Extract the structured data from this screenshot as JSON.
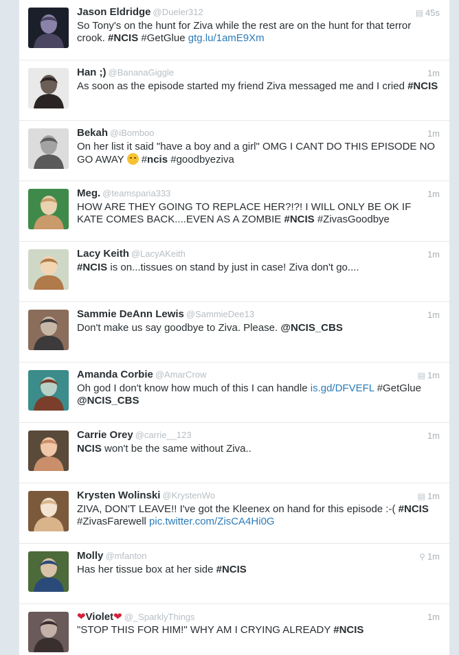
{
  "colors": {
    "link": "#2b7bb9",
    "handle": "#b7bec4",
    "text": "#292f33"
  },
  "tweets": [
    {
      "name": "Jason Eldridge",
      "handle": "@Dueler312",
      "time": "45s",
      "icon": "newspaper-icon",
      "segments": [
        {
          "t": "So Tony's on the hunt for Ziva while the rest are on the hunt for that terror crook. "
        },
        {
          "t": "#NCIS",
          "s": "b"
        },
        {
          "t": " #GetGlue "
        },
        {
          "t": "gtg.lu/1amE9Xm",
          "s": "link"
        }
      ]
    },
    {
      "name": "Han ;)",
      "handle": "@BananaGiggle",
      "time": "1m",
      "icon": "",
      "segments": [
        {
          "t": "As soon as the episode started my friend Ziva messaged me and I cried "
        },
        {
          "t": "#NCIS",
          "s": "b"
        }
      ]
    },
    {
      "name": "Bekah",
      "handle": "@iBomboo",
      "time": "1m",
      "icon": "",
      "segments": [
        {
          "t": "On her list it said \"have a boy and a girl\" OMG I CANT DO THIS EPISODE NO GO AWAY "
        },
        {
          "t": "",
          "s": "emoji"
        },
        {
          "t": " #"
        },
        {
          "t": "ncis",
          "s": "b"
        },
        {
          "t": " #goodbyeziva"
        }
      ]
    },
    {
      "name": "Meg.",
      "handle": "@teamsparia333",
      "time": "1m",
      "icon": "",
      "segments": [
        {
          "t": "HOW ARE THEY GOING TO REPLACE HER?!?! I WILL ONLY BE OK IF KATE COMES BACK....EVEN AS A ZOMBIE "
        },
        {
          "t": "#NCIS",
          "s": "b"
        },
        {
          "t": " #ZivasGoodbye"
        }
      ]
    },
    {
      "name": "Lacy Keith",
      "handle": "@LacyAKeith",
      "time": "1m",
      "icon": "",
      "segments": [
        {
          "t": "#NCIS",
          "s": "b"
        },
        {
          "t": " is on...tissues on stand by just in case!  Ziva don't go...."
        }
      ]
    },
    {
      "name": "Sammie DeAnn Lewis",
      "handle": "@SammieDee13",
      "time": "1m",
      "icon": "",
      "segments": [
        {
          "t": "Don't make us say goodbye to Ziva. Please. "
        },
        {
          "t": "@NCIS_CBS",
          "s": "b"
        }
      ]
    },
    {
      "name": "Amanda Corbie",
      "handle": "@AmarCrow",
      "time": "1m",
      "icon": "newspaper-icon",
      "segments": [
        {
          "t": "Oh god I don't know how much of this I can handle "
        },
        {
          "t": "is.gd/DFVEFL",
          "s": "link"
        },
        {
          "t": " #GetGlue "
        },
        {
          "t": "@NCIS_CBS",
          "s": "b"
        }
      ]
    },
    {
      "name": "Carrie Orey",
      "handle": "@carrie__123",
      "time": "1m",
      "icon": "",
      "segments": [
        {
          "t": "NCIS",
          "s": "b"
        },
        {
          "t": " won't be the same without Ziva.."
        }
      ]
    },
    {
      "name": "Krysten Wolinski",
      "handle": "@KrystenWo",
      "time": "1m",
      "icon": "photo-icon",
      "segments": [
        {
          "t": "ZIVA, DON'T LEAVE!! I've got the Kleenex on hand for this episode :-(  "
        },
        {
          "t": "#NCIS",
          "s": "b"
        },
        {
          "t": " #ZivasFarewell "
        },
        {
          "t": "pic.twitter.com/ZisCA4Hi0G",
          "s": "link"
        }
      ]
    },
    {
      "name": "Molly",
      "handle": "@mfanton",
      "time": "1m",
      "icon": "location-pin-icon",
      "segments": [
        {
          "t": "Has her tissue box at her side "
        },
        {
          "t": "#NCIS",
          "s": "b"
        }
      ]
    },
    {
      "name": "Violet",
      "handle": "@_SparklyThings",
      "time": "1m",
      "icon": "",
      "hearts": true,
      "segments": [
        {
          "t": "\"STOP THIS FOR HIM!\" WHY AM I CRYING ALREADY "
        },
        {
          "t": "#NCIS",
          "s": "b"
        }
      ]
    }
  ]
}
